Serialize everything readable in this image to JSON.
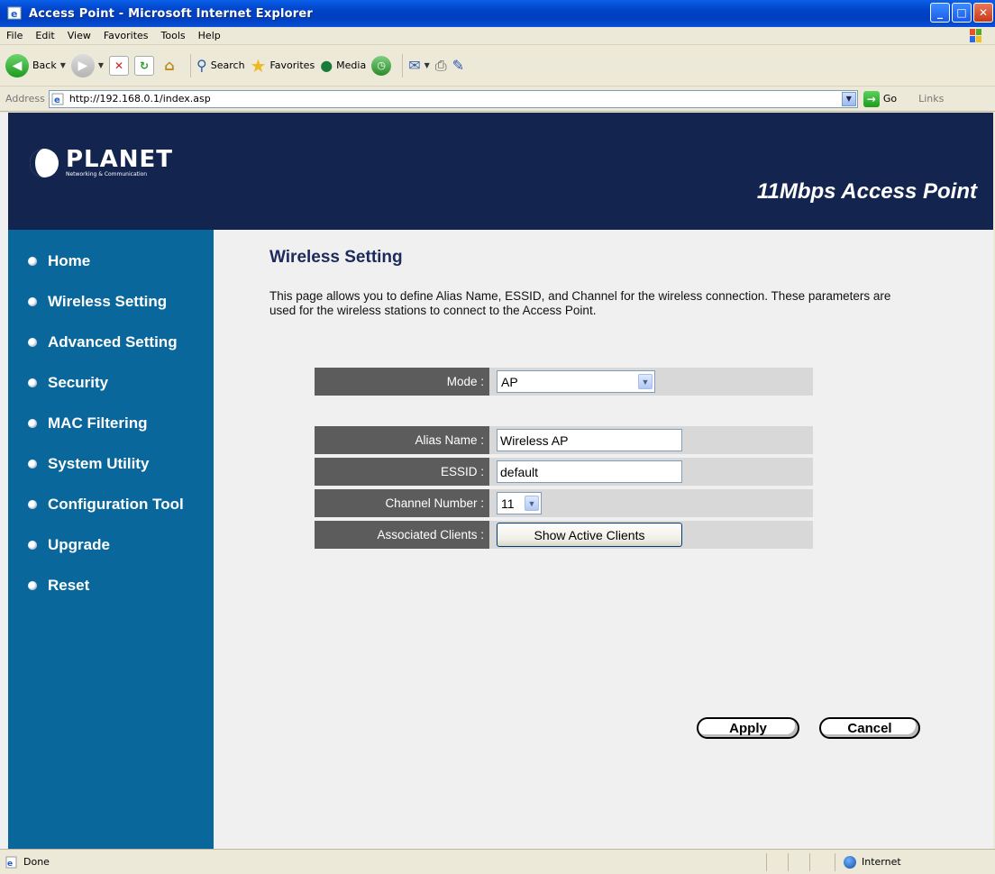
{
  "window": {
    "title": "Access Point - Microsoft Internet Explorer"
  },
  "menu": [
    "File",
    "Edit",
    "View",
    "Favorites",
    "Tools",
    "Help"
  ],
  "toolbar": {
    "back": "Back",
    "search": "Search",
    "favorites": "Favorites",
    "media": "Media"
  },
  "address": {
    "label": "Address",
    "url": "http://192.168.0.1/index.asp",
    "go": "Go",
    "links": "Links"
  },
  "header": {
    "brand": "PLANET",
    "tagline": "Networking & Communication",
    "product": "11Mbps Access Point"
  },
  "sidebar": {
    "items": [
      {
        "label": "Home"
      },
      {
        "label": "Wireless Setting"
      },
      {
        "label": "Advanced Setting"
      },
      {
        "label": "Security"
      },
      {
        "label": "MAC Filtering"
      },
      {
        "label": "System Utility"
      },
      {
        "label": "Configuration Tool"
      },
      {
        "label": "Upgrade"
      },
      {
        "label": "Reset"
      }
    ]
  },
  "main": {
    "title": "Wireless Setting",
    "description": "This page allows you to define Alias Name, ESSID, and Channel for the wireless connection. These parameters are used for the wireless stations to connect to the Access Point.",
    "mode": {
      "label": "Mode :",
      "value": "AP"
    },
    "alias": {
      "label": "Alias Name :",
      "value": "Wireless AP"
    },
    "essid": {
      "label": "ESSID :",
      "value": "default"
    },
    "channel": {
      "label": "Channel Number :",
      "value": "11"
    },
    "clients": {
      "label": "Associated Clients :",
      "button": "Show Active Clients"
    },
    "apply": "Apply",
    "cancel": "Cancel"
  },
  "status": {
    "text": "Done",
    "zone": "Internet"
  }
}
